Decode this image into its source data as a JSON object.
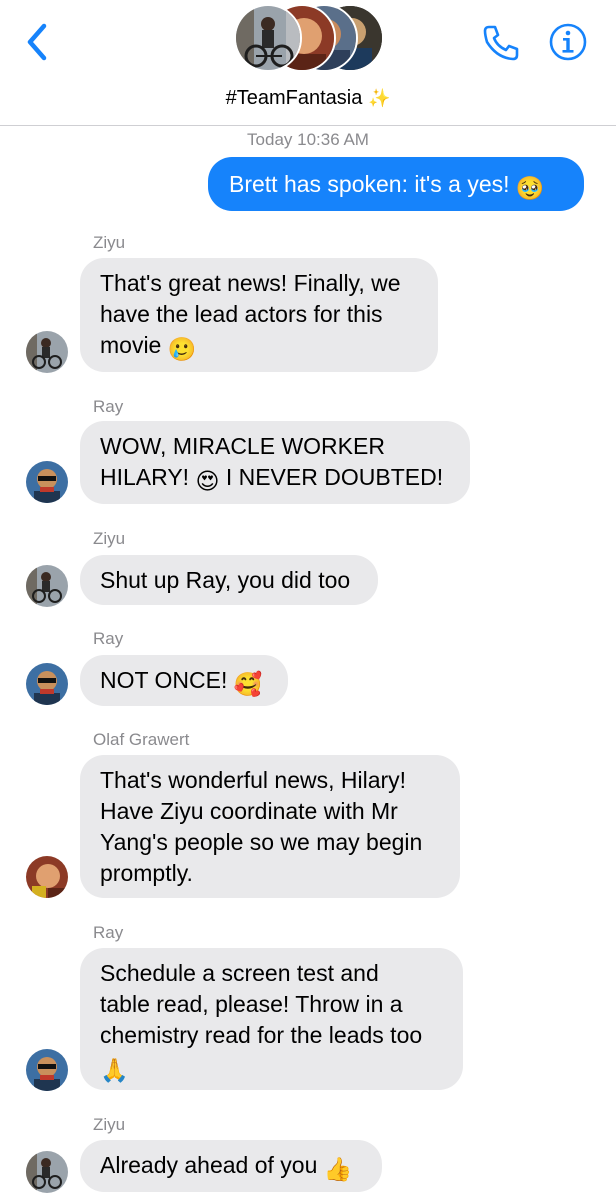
{
  "header": {
    "back_icon": "chevron-left-icon",
    "call_icon": "phone-icon",
    "info_icon": "info-icon",
    "group_name": "#TeamFantasia",
    "group_name_emoji": "✨"
  },
  "timestamp": "Today 10:36 AM",
  "messages": [
    {
      "type": "outgoing",
      "text": "Brett has spoken: it's a yes!",
      "emoji": "🥹"
    },
    {
      "type": "incoming",
      "sender": "Ziyu",
      "lines": [
        "That's great news! Finally, we",
        "have the lead actors for this",
        "movie"
      ],
      "emoji": "🥲"
    },
    {
      "type": "incoming",
      "sender": "Ray",
      "lines": [
        "WOW, MIRACLE WORKER",
        "HILARY!",
        "I NEVER DOUBTED!"
      ],
      "emoji": "😍"
    },
    {
      "type": "incoming",
      "sender": "Ziyu",
      "lines": [
        "Shut up Ray, you did too"
      ]
    },
    {
      "type": "incoming",
      "sender": "Ray",
      "lines": [
        "NOT ONCE!"
      ],
      "emoji": "🥰"
    },
    {
      "type": "incoming",
      "sender": "Olaf Grawert",
      "lines": [
        "That's wonderful news, Hilary!",
        "Have Ziyu coordinate with Mr",
        "Yang's people so we may begin",
        "promptly."
      ]
    },
    {
      "type": "incoming",
      "sender": "Ray",
      "lines": [
        "Schedule a screen test and",
        "table read, please! Throw in a",
        "chemistry read for the leads too"
      ],
      "emoji": "🙏"
    },
    {
      "type": "incoming",
      "sender": "Ziyu",
      "lines": [
        "Already ahead of you"
      ],
      "emoji": "👍"
    }
  ],
  "colors": {
    "accent": "#1683fb",
    "incoming_bubble": "#e9e9eb",
    "meta_text": "#8a8a8e"
  }
}
